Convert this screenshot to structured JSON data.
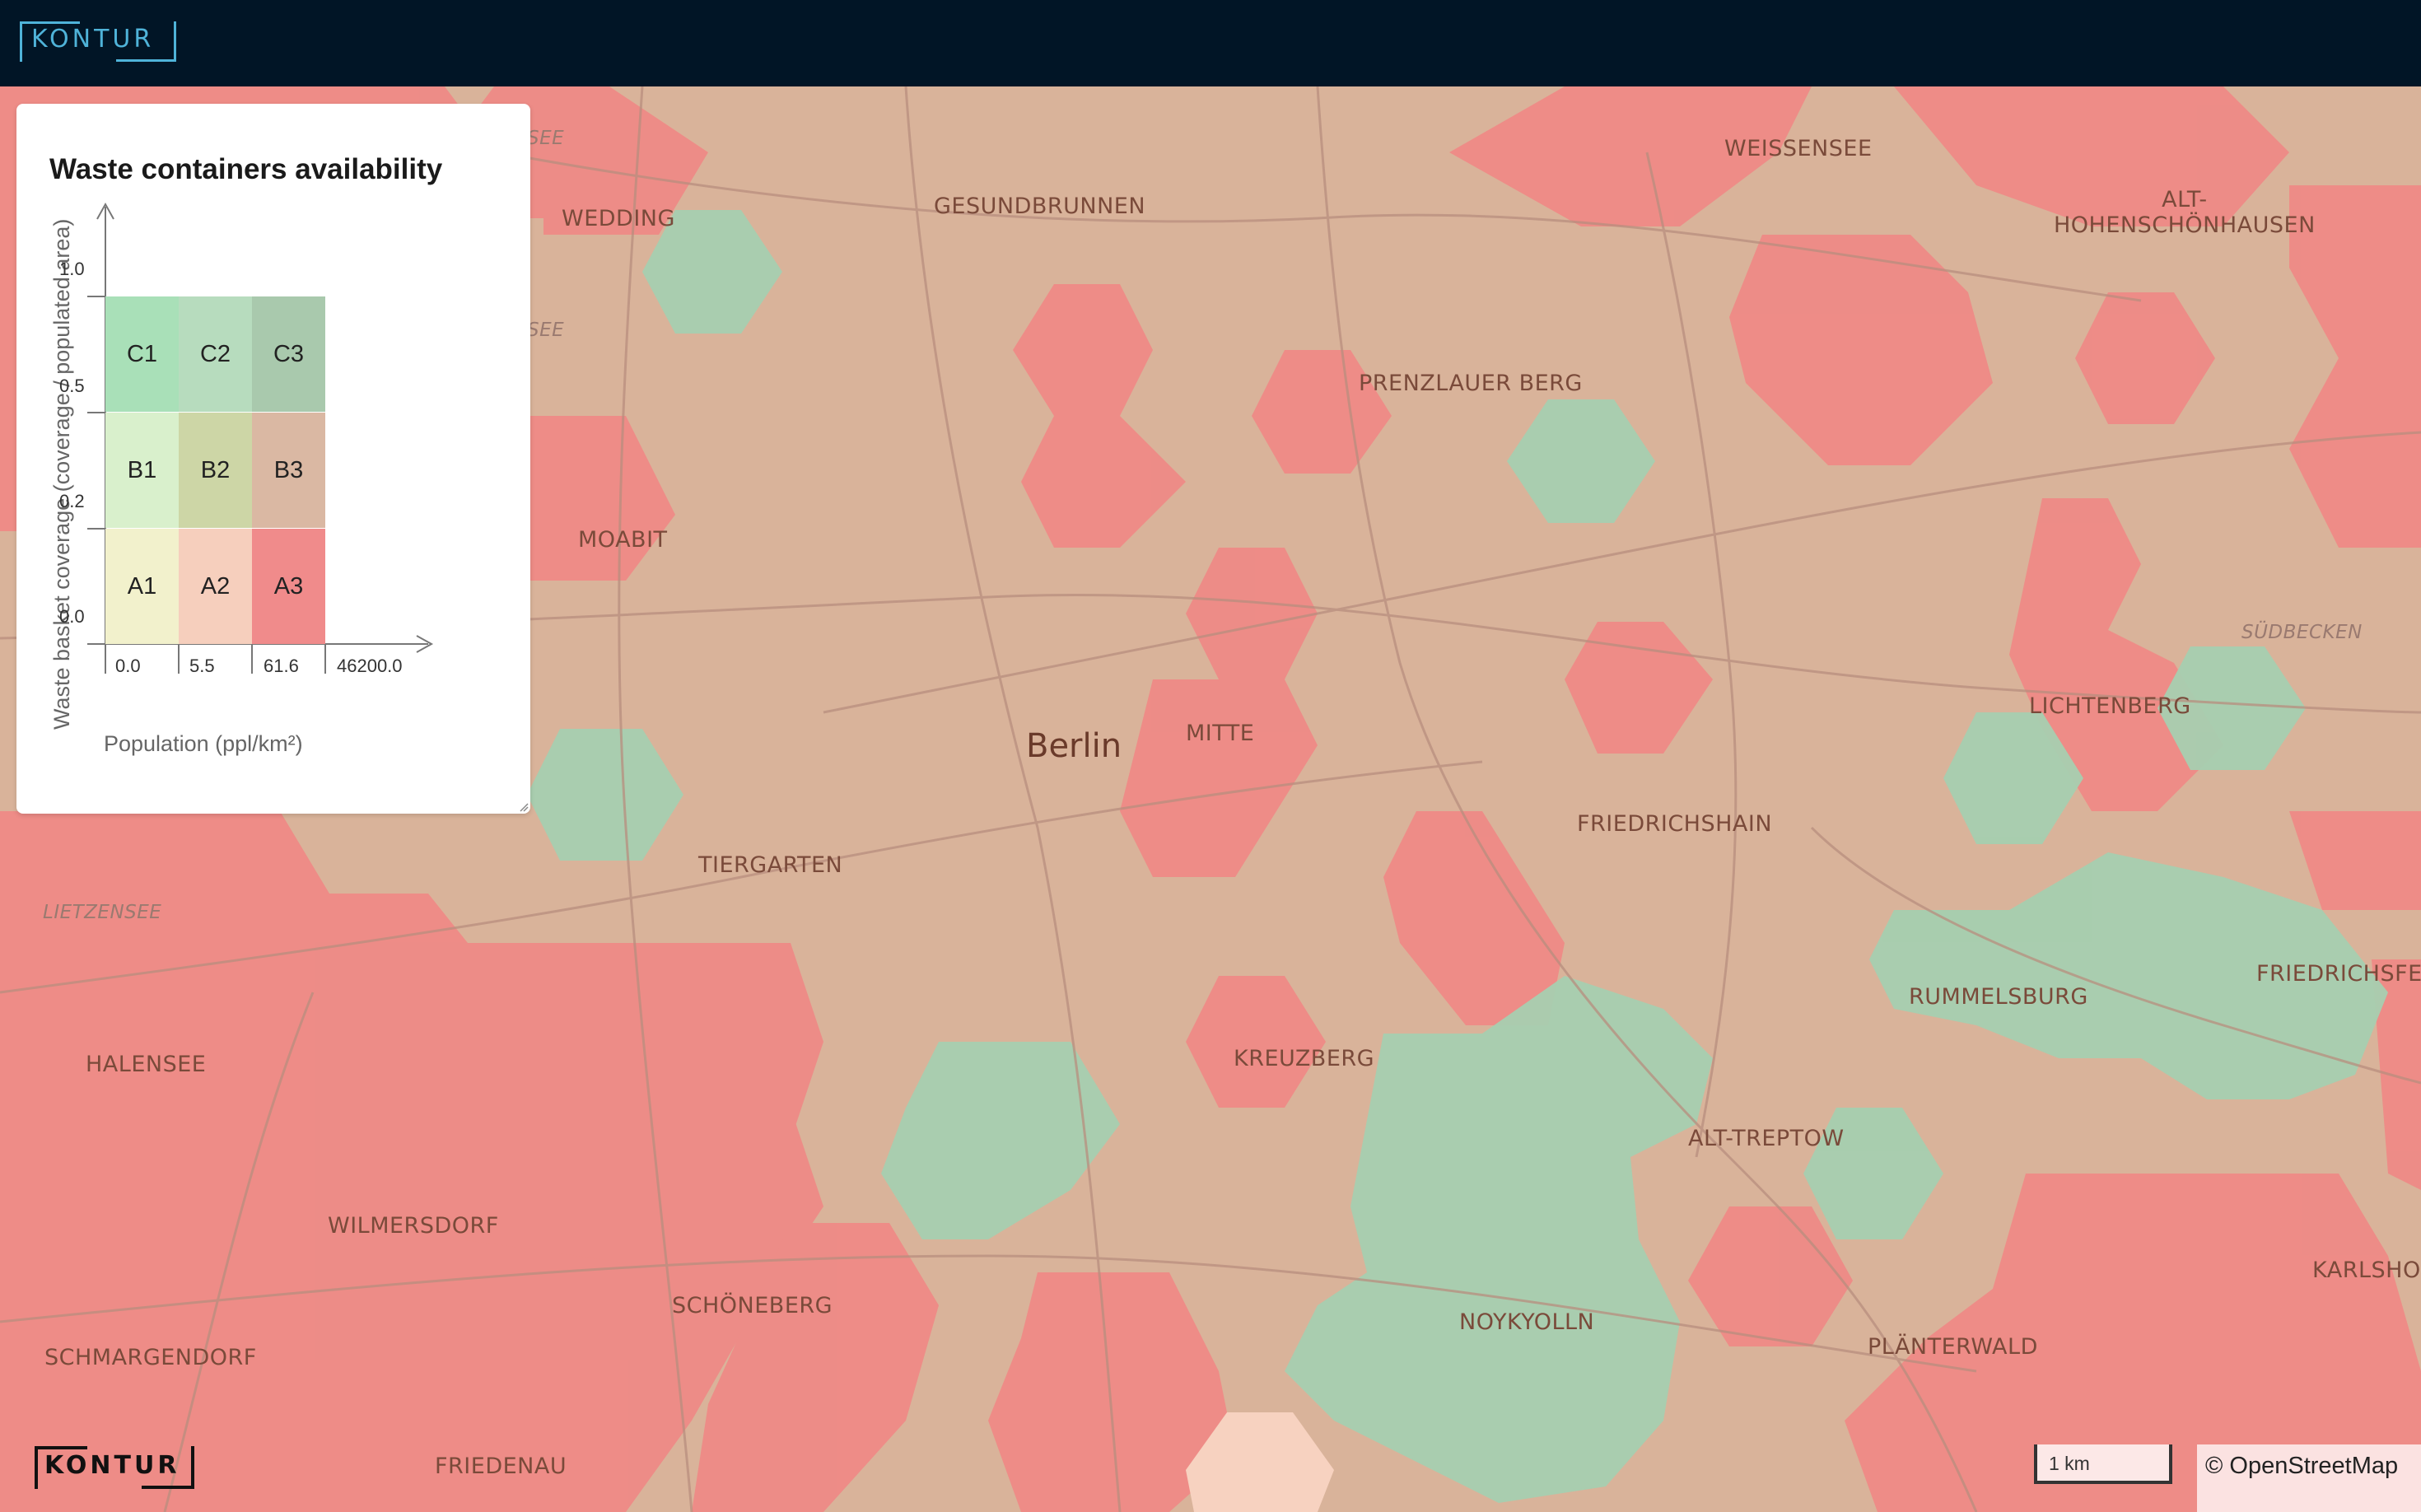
{
  "header": {
    "logo_text": "KONTUR"
  },
  "legend": {
    "title": "Waste containers availability",
    "y_axis_label": "Waste basket coverage (coverage / populated area)",
    "x_axis_label": "Population (ppl/km²)",
    "y_ticks": [
      "1.0",
      "0.5",
      "0.2",
      "0.0"
    ],
    "x_ticks": [
      "0.0",
      "5.5",
      "61.6",
      "46200.0"
    ],
    "cells": {
      "c1": {
        "label": "C1",
        "color": "#a9e0b8"
      },
      "c2": {
        "label": "C2",
        "color": "#b7dcbe"
      },
      "c3": {
        "label": "C3",
        "color": "#a9c9ad"
      },
      "b1": {
        "label": "B1",
        "color": "#d9f0cc"
      },
      "b2": {
        "label": "B2",
        "color": "#cdd6a6"
      },
      "b3": {
        "label": "B3",
        "color": "#dab8a3"
      },
      "a1": {
        "label": "A1",
        "color": "#f2f1cc"
      },
      "a2": {
        "label": "A2",
        "color": "#f6cfbd"
      },
      "a3": {
        "label": "A3",
        "color": "#f08b8b"
      }
    }
  },
  "map": {
    "labels": {
      "weissensee": "WEISSENSEE",
      "alt_hohen": "ALT-\nHOHENSCHÖNHAUSEN",
      "wedding": "WEDDING",
      "gesundbrunnen": "GESUNDBRUNNEN",
      "prenzlauer": "PRENZLAUER BERG",
      "moabit": "MOABIT",
      "suedbecken": "SÜDBECKEN",
      "lichtenberg": "LICHTENBERG",
      "berlin": "Berlin",
      "mitte": "MITTE",
      "friedrichshain": "FRIEDRICHSHAIN",
      "tiergarten": "TIERGARTEN",
      "lietzensee": "LIETZENSEE",
      "rummelsburg": "RUMMELSBURG",
      "friedrichsfelde": "FRIEDRICHSFELD",
      "halensee": "HALENSEE",
      "kreuzberg": "KREUZBERG",
      "alt_treptow": "ALT-TREPTOW",
      "wilmersdorf": "WILMERSDORF",
      "schoeneberg": "SCHÖNEBERG",
      "noykyolln": "NOYKYOLLN",
      "karlshorst": "KARLSHOR",
      "schmargendorf": "SCHMARGENDORF",
      "plaenterwald": "PLÄNTERWALD",
      "friedenau": "FRIEDENAU",
      "see_top": "SEE",
      "see_mid": "SEE"
    }
  },
  "footer": {
    "logo_text": "KONTUR",
    "scale_label": "1 km",
    "attribution": "© OpenStreetMap"
  }
}
